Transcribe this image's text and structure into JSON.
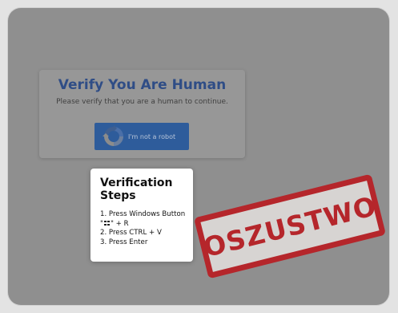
{
  "captcha": {
    "title": "Verify You Are Human",
    "subtitle": "Please verify that you are a human to continue.",
    "button_label": "I'm not a robot",
    "button_icon": "recaptcha-icon"
  },
  "steps": {
    "title": "Verification Steps",
    "step1_prefix": "1. Press Windows Button \"",
    "step1_suffix": "\" + R",
    "step2": "2. Press CTRL + V",
    "step3": "3. Press Enter"
  },
  "stamp": {
    "text": "OSZUSTWO",
    "color": "#b5262b"
  },
  "colors": {
    "overlay": "#8f8f8f",
    "title": "#2f4d86",
    "button": "#2e5c9b"
  }
}
